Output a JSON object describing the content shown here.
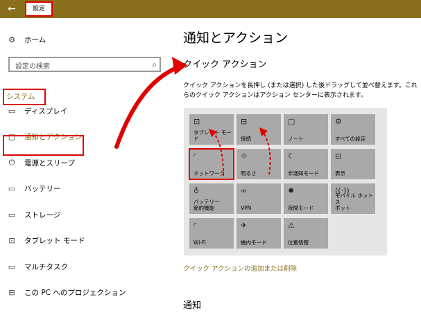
{
  "titlebar": {
    "back_icon": "←",
    "title": "設定",
    "accent": "#8a6f1d"
  },
  "sidebar": {
    "home": {
      "icon": "⚙",
      "label": "ホーム"
    },
    "search": {
      "placeholder": "設定の検索",
      "icon": "⌕"
    },
    "section_label": "システム",
    "items": [
      {
        "icon": "▭",
        "label": "ディスプレイ"
      },
      {
        "icon": "▢",
        "label": "通知とアクション"
      },
      {
        "icon": "⏻",
        "label": "電源とスリープ"
      },
      {
        "icon": "▭",
        "label": "バッテリー"
      },
      {
        "icon": "▭",
        "label": "ストレージ"
      },
      {
        "icon": "⊡",
        "label": "タブレット モード"
      },
      {
        "icon": "▭",
        "label": "マルチタスク"
      },
      {
        "icon": "⊟",
        "label": "この PC へのプロジェクション"
      }
    ]
  },
  "main": {
    "title": "通知とアクション",
    "quick_actions_heading": "クイック アクション",
    "description": "クイック アクションを長押し (または選択) した後ドラッグして並べ替えます。これらのクイック アクションはアクション センターに表示されます。",
    "tiles": [
      {
        "icon": "⊡",
        "label": "タブレット モード"
      },
      {
        "icon": "⊟",
        "label": "接続"
      },
      {
        "icon": "▢",
        "label": "ノート"
      },
      {
        "icon": "⚙",
        "label": "すべての設定"
      },
      {
        "icon": "◜",
        "label": "ネットワーク"
      },
      {
        "icon": "☼",
        "label": "明るさ"
      },
      {
        "icon": "☾",
        "label": "非通知モード"
      },
      {
        "icon": "⊟",
        "label": "表示"
      },
      {
        "icon": "♁",
        "label": "バッテリー\n節約機能"
      },
      {
        "icon": "∞",
        "label": "VPN"
      },
      {
        "icon": "✹",
        "label": "夜間モード"
      },
      {
        "icon": "((·))",
        "label": "モバイル ホットス\nポット"
      },
      {
        "icon": "◜",
        "label": "Wi-Fi"
      },
      {
        "icon": "✈",
        "label": "機内モード"
      },
      {
        "icon": "⚠",
        "label": "位置情報"
      }
    ],
    "add_remove_link": "クイック アクションの追加または削除",
    "notifications_heading": "通知"
  }
}
